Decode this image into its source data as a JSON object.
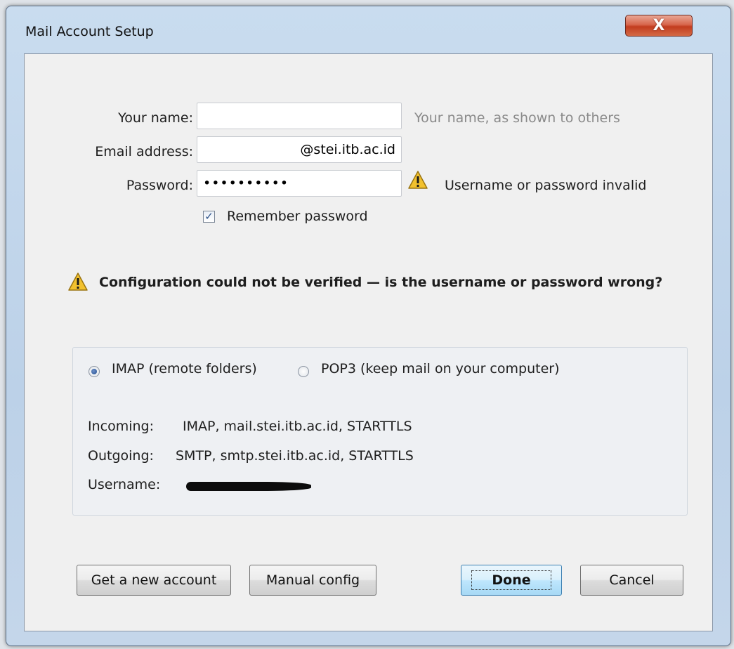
{
  "window": {
    "title": "Mail Account Setup",
    "close_label": "X"
  },
  "form": {
    "name_label": "Your name:",
    "name_value": "",
    "name_hint": "Your name, as shown to others",
    "email_label": "Email address:",
    "email_value": "@stei.itb.ac.id",
    "password_label": "Password:",
    "password_value": "••••••••••",
    "password_warning": "Username or password invalid",
    "remember_label": "Remember password",
    "remember_checked": true
  },
  "error_message": "Configuration could not be verified — is the username or password wrong?",
  "protocol": {
    "imap_label": "IMAP (remote folders)",
    "pop3_label": "POP3 (keep mail on your computer)",
    "selected": "IMAP"
  },
  "server_details": {
    "incoming_label": "Incoming:",
    "incoming_value": "IMAP, mail.stei.itb.ac.id, STARTTLS",
    "outgoing_label": "Outgoing:",
    "outgoing_value": "SMTP, smtp.stei.itb.ac.id, STARTTLS",
    "username_label": "Username:"
  },
  "buttons": {
    "new_account": "Get a new account",
    "manual_config": "Manual config",
    "done": "Done",
    "cancel": "Cancel"
  },
  "colors": {
    "warning": "#f2c12e",
    "close_button": "#c7432a",
    "default_button": "#3c7fb1"
  }
}
